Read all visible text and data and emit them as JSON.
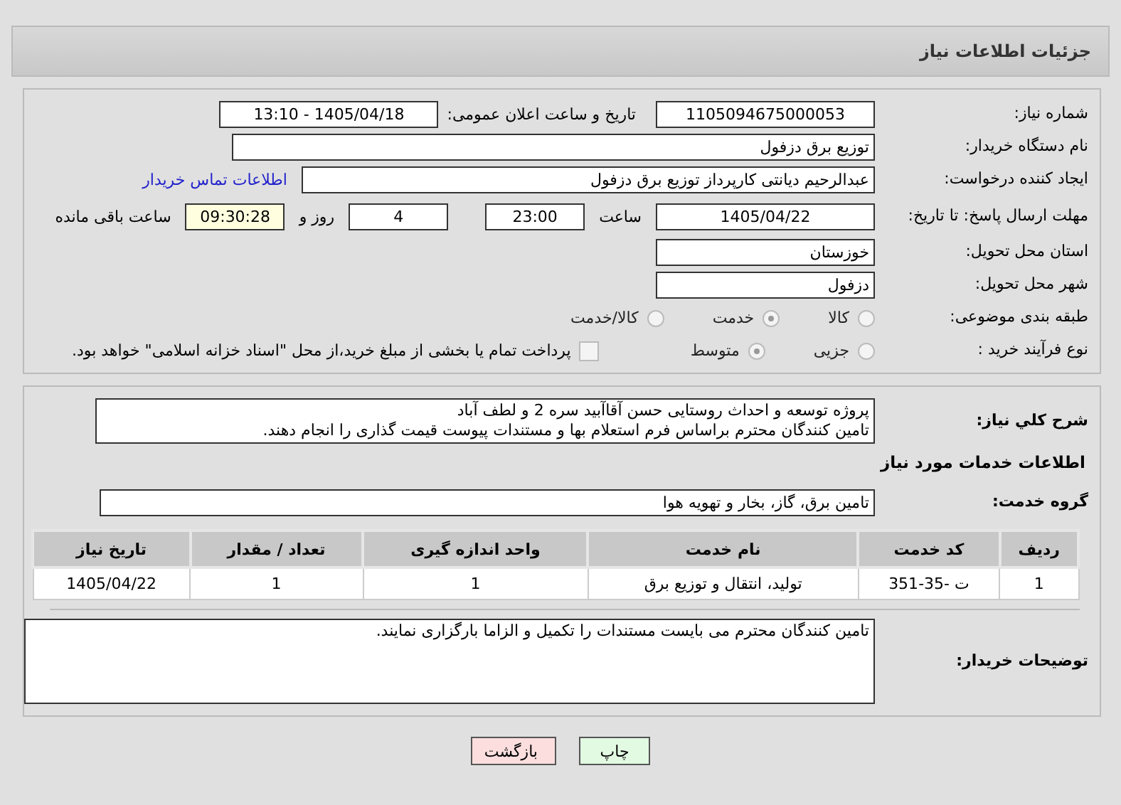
{
  "header": {
    "title": "جزئیات اطلاعات نیاز"
  },
  "need_info": {
    "need_number": {
      "label": "شماره نیاز:",
      "value": "1105094675000053"
    },
    "announce_datetime": {
      "label": "تاریخ و ساعت اعلان عمومی:",
      "value": "1405/04/18 - 13:10"
    },
    "buyer_org": {
      "label": "نام دستگاه خریدار:",
      "value": "توزیع برق دزفول"
    },
    "requester": {
      "label": "ایجاد کننده درخواست:",
      "value": "عبدالرحیم دیانتی کارپرداز توزیع برق دزفول",
      "link": "اطلاعات تماس خریدار"
    },
    "deadline": {
      "label": "مهلت ارسال پاسخ: تا تاریخ:",
      "date": "1405/04/22",
      "time_label": "ساعت",
      "time": "23:00",
      "days": "4",
      "days_label": "روز و",
      "remaining": "09:30:28",
      "remaining_label": "ساعت باقی مانده"
    },
    "province": {
      "label": "استان محل تحویل:",
      "value": "خوزستان"
    },
    "city": {
      "label": "شهر محل تحویل:",
      "value": "دزفول"
    },
    "category": {
      "label": "طبقه بندی موضوعی:",
      "options": [
        {
          "label": "کالا",
          "selected": false
        },
        {
          "label": "خدمت",
          "selected": true
        },
        {
          "label": "کالا/خدمت",
          "selected": false
        }
      ]
    },
    "purchase_type": {
      "label": "نوع فرآیند خرید :",
      "options": [
        {
          "label": "جزیی",
          "selected": false
        },
        {
          "label": "متوسط",
          "selected": true
        }
      ],
      "payment_check": {
        "label": "پرداخت تمام یا بخشی از مبلغ خرید،از محل \"اسناد خزانه اسلامی\" خواهد بود.",
        "checked": false
      }
    }
  },
  "details": {
    "summary": {
      "label": "شرح کلي نياز:",
      "lines": [
        "پروژه توسعه و احداث روستایی حسن آقاآبید سره 2 و لطف آباد",
        "تامین کنندگان محترم براساس فرم استعلام بها و مستندات پیوست قیمت گذاری را انجام دهند."
      ]
    },
    "services_heading": "اطلاعات خدمات مورد نیاز",
    "service_group": {
      "label": "گروه خدمت:",
      "value": "تامین برق، گاز، بخار و تهویه هوا"
    },
    "table": {
      "columns": [
        "ردیف",
        "کد خدمت",
        "نام خدمت",
        "واحد اندازه گیری",
        "تعداد / مقدار",
        "تاریخ نیاز"
      ],
      "rows": [
        [
          "1",
          "ت -35-351",
          "تولید، انتقال و توزیع برق",
          "1",
          "1",
          "1405/04/22"
        ]
      ]
    },
    "buyer_notes": {
      "label": "توضیحات خریدار:",
      "value": "تامین کنندگان محترم می بایست مستندات را تکمیل و الزاما بارگزاری نمایند."
    }
  },
  "buttons": [
    {
      "label": "چاپ",
      "kind": "print"
    },
    {
      "label": "بازگشت",
      "kind": "back"
    }
  ]
}
